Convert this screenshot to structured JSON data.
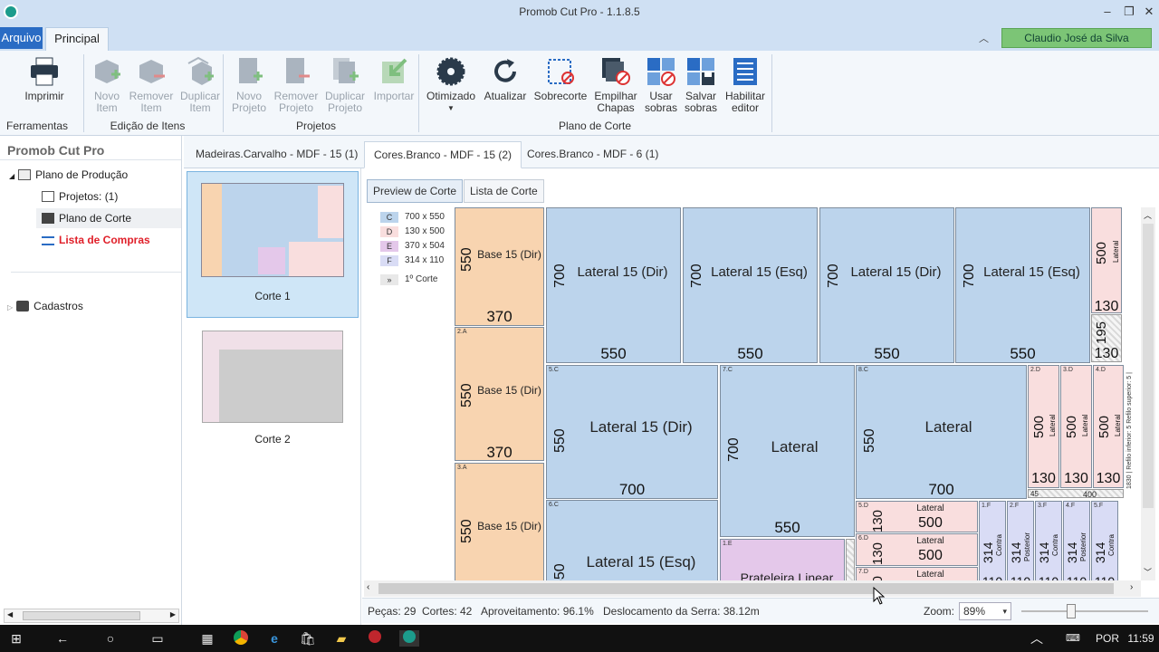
{
  "window": {
    "title": "Promob Cut Pro - 1.1.8.5"
  },
  "menu": {
    "arquivo": "Arquivo",
    "principal": "Principal",
    "user": "Claudio José da Silva Carneiro"
  },
  "ribbon": {
    "buttons": [
      {
        "label": "Imprimir",
        "group": "Ferramentas",
        "enabled": true
      },
      {
        "label": "Novo\nItem",
        "enabled": false
      },
      {
        "label": "Remover\nItem",
        "enabled": false
      },
      {
        "label": "Duplicar\nItem",
        "enabled": false
      },
      {
        "label": "Novo\nProjeto",
        "enabled": false
      },
      {
        "label": "Remover\nProjeto",
        "enabled": false
      },
      {
        "label": "Duplicar\nProjeto",
        "enabled": false
      },
      {
        "label": "Importar",
        "enabled": false
      },
      {
        "label": "Otimizado",
        "enabled": true
      },
      {
        "label": "Atualizar",
        "enabled": true
      },
      {
        "label": "Sobrecorte",
        "enabled": true
      },
      {
        "label": "Empilhar\nChapas",
        "enabled": true
      },
      {
        "label": "Usar\nsobras",
        "enabled": true
      },
      {
        "label": "Salvar\nsobras",
        "enabled": true
      },
      {
        "label": "Habilitar\neditor",
        "enabled": true
      }
    ],
    "groups": [
      "Ferramentas",
      "Edição de Itens",
      "Projetos",
      "Plano de Corte"
    ]
  },
  "sidebar": {
    "title": "Promob Cut Pro",
    "items": [
      "Plano de Produção",
      "Projetos: (1)",
      "Plano de Corte",
      "Lista de Compras",
      "Cadastros"
    ]
  },
  "tabs": [
    "Madeiras.Carvalho - MDF - 15 (1)",
    "Cores.Branco - MDF - 15 (2)",
    "Cores.Branco - MDF - 6 (1)"
  ],
  "thumbs": [
    "Corte 1",
    "Corte 2"
  ],
  "view_tabs": [
    "Preview de Corte",
    "Lista de Corte"
  ],
  "legend": [
    {
      "letter": "C",
      "dims": "700 x 550",
      "color": "#bcd4ec"
    },
    {
      "letter": "D",
      "dims": "130 x 500",
      "color": "#f9dede"
    },
    {
      "letter": "E",
      "dims": "370 x 504",
      "color": "#e4c8ea"
    },
    {
      "letter": "F",
      "dims": "314 x 110",
      "color": "#d9dcf5"
    },
    {
      "letter": "»",
      "dims": "1º Corte",
      "color": "#e8e8e8"
    }
  ],
  "plan": {
    "base_name": "Base 15 (Dir)",
    "base_w": "370",
    "base_h": "550",
    "lat_dir": "Lateral 15 (Dir)",
    "lat_esq": "Lateral 15 (Esq)",
    "lateral": "Lateral",
    "prateleira": "Prateleira Linear",
    "contra": "Contra",
    "posterior": "Posterior",
    "v700": "700",
    "v550": "550",
    "v500": "500",
    "v130": "130",
    "v195": "195",
    "v400": "400",
    "v314": "314",
    "v110": "110",
    "v45": "45",
    "margin_note": "1830 | Refilo inferior: 5  Refilo superior: 5 |"
  },
  "status": {
    "pecas": "Peças: 29",
    "cortes": "Cortes: 42",
    "aproveitamento": "Aproveitamento: 96.1%",
    "deslocamento": "Deslocamento da Serra: 38.12m",
    "zoom_label": "Zoom:",
    "zoom": "89%"
  },
  "taskbar": {
    "lang": "POR",
    "time": "11:59"
  }
}
